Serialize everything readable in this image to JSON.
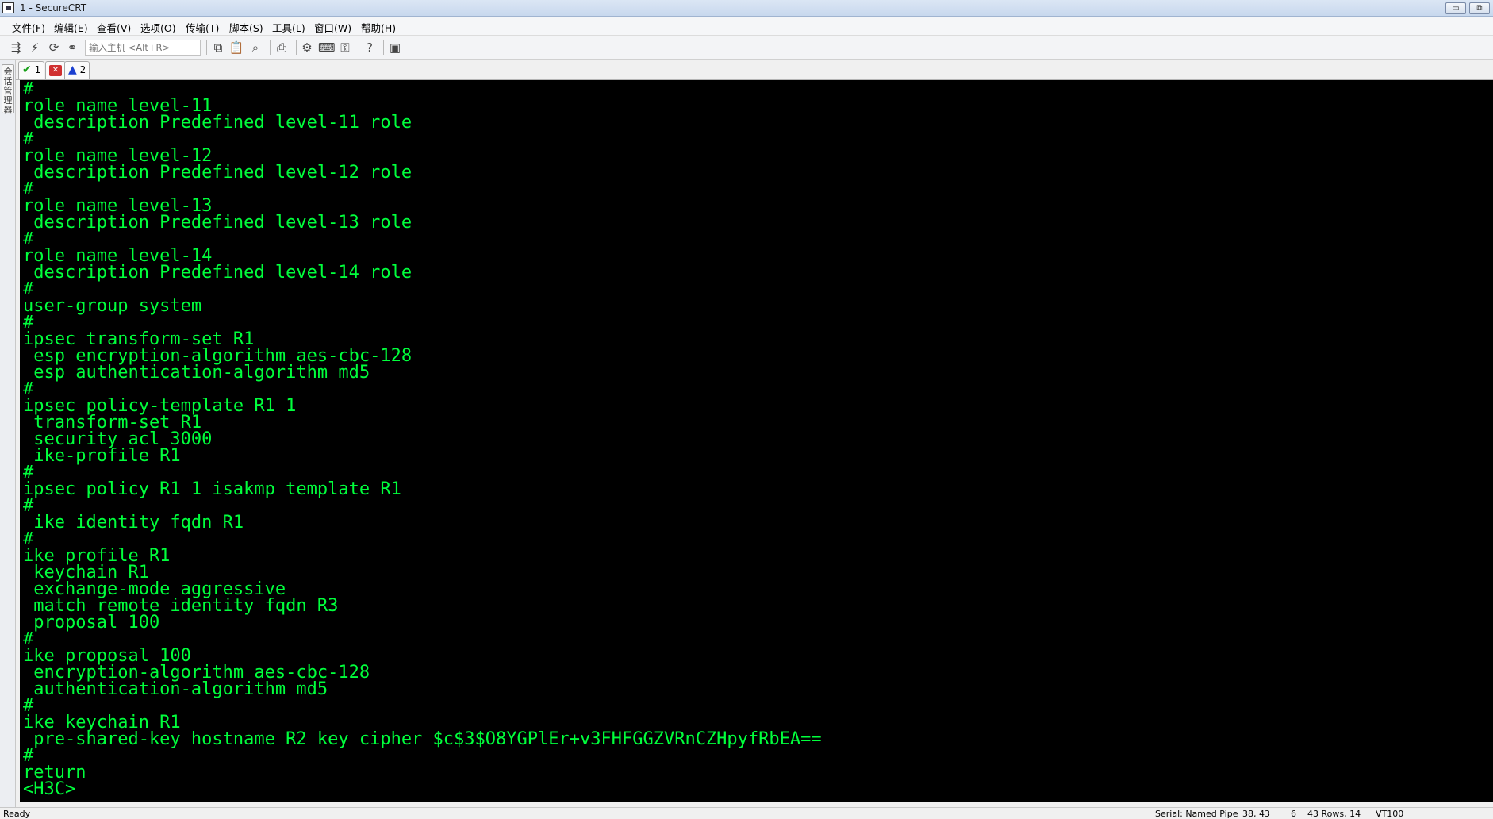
{
  "window": {
    "title": "1 - SecureCRT",
    "minimize_label": "▭",
    "restore_label": "⧉"
  },
  "menu": {
    "items": [
      "文件(F)",
      "编辑(E)",
      "查看(V)",
      "选项(O)",
      "传输(T)",
      "脚本(S)",
      "工具(L)",
      "窗口(W)",
      "帮助(H)"
    ]
  },
  "toolbar": {
    "host_placeholder": "输入主机 <Alt+R>"
  },
  "sidebar": {
    "session_manager_label": "会话管理器"
  },
  "tabs": [
    {
      "label": "1",
      "status": "connected"
    },
    {
      "label": "",
      "status": "disconnected"
    },
    {
      "label": "2",
      "status": "warning"
    }
  ],
  "terminal": {
    "lines": [
      "#",
      "role name level-11",
      " description Predefined level-11 role",
      "#",
      "role name level-12",
      " description Predefined level-12 role",
      "#",
      "role name level-13",
      " description Predefined level-13 role",
      "#",
      "role name level-14",
      " description Predefined level-14 role",
      "#",
      "user-group system",
      "#",
      "ipsec transform-set R1",
      " esp encryption-algorithm aes-cbc-128",
      " esp authentication-algorithm md5",
      "#",
      "ipsec policy-template R1 1",
      " transform-set R1",
      " security acl 3000",
      " ike-profile R1",
      "#",
      "ipsec policy R1 1 isakmp template R1",
      "#",
      " ike identity fqdn R1",
      "#",
      "ike profile R1",
      " keychain R1",
      " exchange-mode aggressive",
      " match remote identity fqdn R3",
      " proposal 100",
      "#",
      "ike proposal 100",
      " encryption-algorithm aes-cbc-128",
      " authentication-algorithm md5",
      "#",
      "ike keychain R1",
      " pre-shared-key hostname R2 key cipher $c$3$O8YGPlEr+v3FHFGGZVRnCZHpyfRbEA==",
      "#",
      "return",
      "<H3C>"
    ],
    "text_color": "#00ff3c",
    "background": "#000000"
  },
  "status": {
    "ready": "Ready",
    "connection": "Serial: Named Pipe",
    "position": "38,  43",
    "col": "6",
    "size": "43 Rows, 14",
    "emulation": "VT100"
  }
}
